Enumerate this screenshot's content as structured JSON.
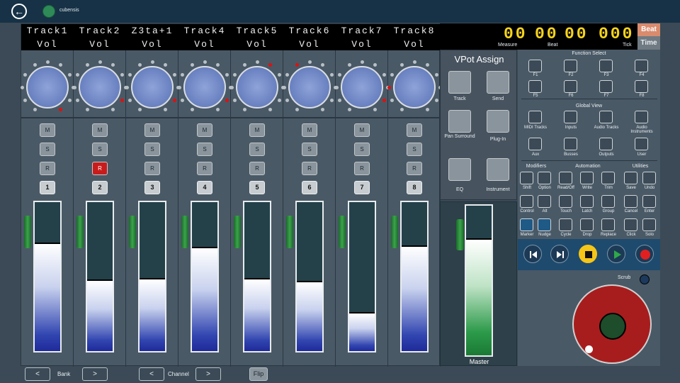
{
  "header": {
    "back_icon": "back-arrow-icon",
    "app_name": "cubensis",
    "status_color": "#2e8b57"
  },
  "lcd": {
    "names": [
      "Track1",
      "Track2",
      "Z3ta+1",
      "Track4",
      "Track5",
      "Track6",
      "Track7",
      "Track8"
    ],
    "params": [
      "Vol",
      "Vol",
      "Vol",
      "Vol",
      "Vol",
      "Vol",
      "Vol",
      "Vol"
    ]
  },
  "channels": [
    {
      "number": "1",
      "mute": "M",
      "solo": "S",
      "rec": "R",
      "rec_armed": false,
      "fader": 0.73
    },
    {
      "number": "2",
      "mute": "M",
      "solo": "S",
      "rec": "R",
      "rec_armed": true,
      "fader": 0.48
    },
    {
      "number": "3",
      "mute": "M",
      "solo": "S",
      "rec": "R",
      "rec_armed": false,
      "fader": 0.49
    },
    {
      "number": "4",
      "mute": "M",
      "solo": "S",
      "rec": "R",
      "rec_armed": false,
      "fader": 0.7
    },
    {
      "number": "5",
      "mute": "M",
      "solo": "S",
      "rec": "R",
      "rec_armed": false,
      "fader": 0.49
    },
    {
      "number": "6",
      "mute": "M",
      "solo": "S",
      "rec": "R",
      "rec_armed": false,
      "fader": 0.47
    },
    {
      "number": "7",
      "mute": "M",
      "solo": "S",
      "rec": "R",
      "rec_armed": false,
      "fader": 0.26
    },
    {
      "number": "8",
      "mute": "M",
      "solo": "S",
      "rec": "R",
      "rec_armed": false,
      "fader": 0.71
    }
  ],
  "vpot_levels": [
    10,
    9,
    9,
    9,
    6,
    4,
    9,
    2
  ],
  "nav": {
    "bank_label": "Bank",
    "channel_label": "Channel",
    "prev": "<",
    "next": ">",
    "flip": "Flip"
  },
  "timecode": {
    "measure": "00",
    "beat": "00",
    "sub": "00",
    "tick": "000",
    "measure_label": "Measure",
    "beat_label": "Beat",
    "tick_label": "Tick",
    "beat_mode": "Beat",
    "time_mode": "Time"
  },
  "vpot_assign": {
    "title": "VPot Assign",
    "buttons": [
      "Track",
      "Send",
      "Pan Surround",
      "Plug-In",
      "EQ",
      "Instrument"
    ]
  },
  "master": {
    "label": "Master",
    "fader": 0.78
  },
  "function_select": {
    "title": "Function Select",
    "keys": [
      "F1",
      "F2",
      "F3",
      "F4",
      "F5",
      "F6",
      "F7",
      "F8"
    ]
  },
  "global_view": {
    "title": "Global View",
    "items": [
      "MIDI Tracks",
      "Inputs",
      "Audio Tracks",
      "Audio Instruments",
      "Aux",
      "Busses",
      "Outputs",
      "User"
    ]
  },
  "modifiers": {
    "title": "Modifiers",
    "items": [
      "Shift",
      "Option",
      "Control",
      "Alt",
      "Marker",
      "Nudge"
    ]
  },
  "automation": {
    "title": "Automation",
    "items": [
      "Read/Off",
      "Write",
      "Trim",
      "Touch",
      "Latch",
      "Group",
      "Cycle",
      "Drop",
      "Replace"
    ]
  },
  "utilities": {
    "title": "Utilities",
    "items": [
      "Save",
      "Undo",
      "Cancel",
      "Enter",
      "Click",
      "Solo"
    ]
  },
  "transport": {
    "icons": [
      "rewind-icon",
      "fast-forward-icon",
      "stop-icon",
      "play-icon",
      "record-icon"
    ]
  },
  "scrub": {
    "label": "Scrub"
  }
}
